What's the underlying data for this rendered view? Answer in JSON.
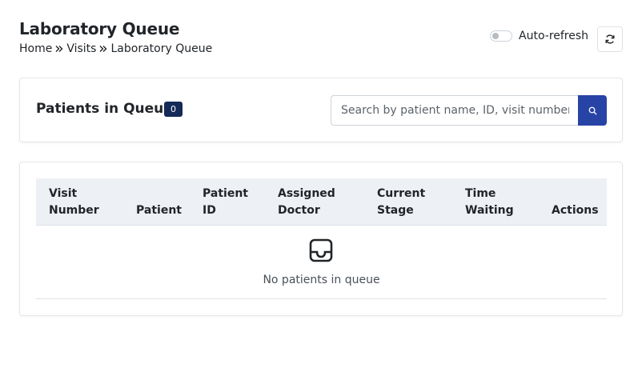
{
  "header": {
    "title": "Laboratory Queue",
    "breadcrumb": [
      "Home",
      "Visits",
      "Laboratory Queue"
    ],
    "auto_refresh_label": "Auto-refresh",
    "auto_refresh_on": false
  },
  "queue": {
    "title": "Patients in Queue",
    "count": "0",
    "search_placeholder": "Search by patient name, ID, visit number..."
  },
  "table": {
    "columns": [
      [
        "Visit",
        "Number"
      ],
      [
        "Patient"
      ],
      [
        "Patient",
        "ID"
      ],
      [
        "Assigned",
        "Doctor"
      ],
      [
        "Current",
        "Stage"
      ],
      [
        "Time",
        "Waiting"
      ],
      [
        "Actions"
      ]
    ],
    "empty_message": "No patients in queue"
  },
  "colors": {
    "badge": "#142a57",
    "search_button": "#2743a5",
    "table_header_bg": "#edf0f4"
  },
  "icons": {
    "breadcrumb_separator": "chevron-double-right-icon",
    "refresh": "refresh-icon",
    "search": "search-icon",
    "empty": "inbox-icon"
  }
}
